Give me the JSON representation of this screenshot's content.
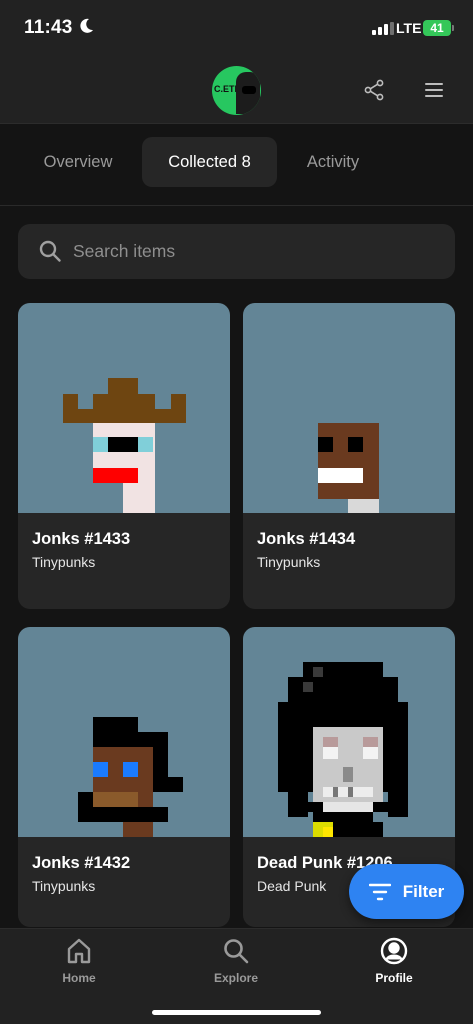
{
  "status_bar": {
    "time": "11:43",
    "network": "LTE",
    "battery": "41"
  },
  "header": {
    "avatar_text": "C.ETH"
  },
  "tabs": [
    {
      "label": "Overview"
    },
    {
      "label": "Collected 8"
    },
    {
      "label": "Activity"
    }
  ],
  "search": {
    "placeholder": "Search items"
  },
  "items": [
    {
      "name": "Jonks #1433",
      "collection": "Tinypunks"
    },
    {
      "name": "Jonks #1434",
      "collection": "Tinypunks"
    },
    {
      "name": "Jonks #1432",
      "collection": "Tinypunks"
    },
    {
      "name": "Dead Punk #1206",
      "collection": "Dead Punk"
    }
  ],
  "filter_button": {
    "label": "Filter"
  },
  "bottom_nav": [
    {
      "label": "Home"
    },
    {
      "label": "Explore"
    },
    {
      "label": "Profile"
    }
  ],
  "colors": {
    "accent": "#2e83f2",
    "nft_background": "#638596",
    "avatar_green": "#27c760",
    "battery_green": "#34c759"
  }
}
